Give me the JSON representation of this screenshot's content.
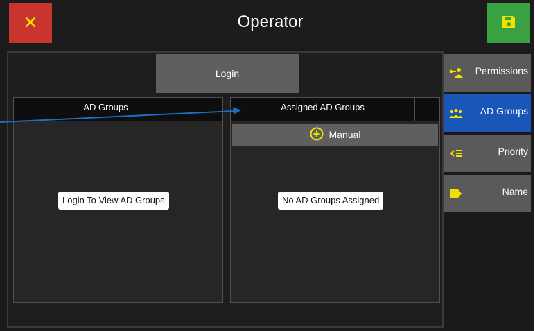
{
  "header": {
    "title": "Operator",
    "close_icon": "close-icon",
    "save_icon": "save-icon"
  },
  "main": {
    "login_label": "Login",
    "left_panel": {
      "header": "AD Groups",
      "empty_message": "Login To View AD Groups"
    },
    "right_panel": {
      "header": "Assigned AD Groups",
      "manual_label": "Manual",
      "empty_message": "No AD Groups Assigned"
    }
  },
  "sidebar": {
    "items": [
      {
        "label": "Permissions",
        "icon": "permissions-icon",
        "active": false
      },
      {
        "label": "AD Groups",
        "icon": "groups-icon",
        "active": true
      },
      {
        "label": "Priority",
        "icon": "priority-icon",
        "active": false
      },
      {
        "label": "Name",
        "icon": "tag-icon",
        "active": false
      }
    ]
  },
  "colors": {
    "close": "#c8352e",
    "save": "#3aa142",
    "active_tab": "#1a55b8",
    "icon_yellow": "#f2e000",
    "annotation_arrow": "#1a6fc0"
  }
}
